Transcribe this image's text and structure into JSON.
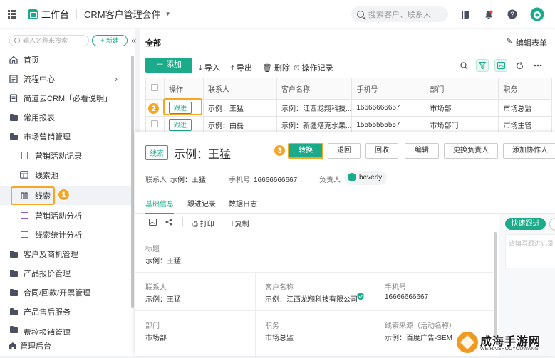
{
  "topbar": {
    "workspace": "工作台",
    "app_name": "CRM客户管理套件",
    "search_placeholder": "搜索客户、联系人"
  },
  "sidebar": {
    "search_placeholder": "输入名称来搜索",
    "new_label": "+ 新建",
    "items": [
      {
        "label": "首页"
      },
      {
        "label": "流程中心"
      },
      {
        "label": "简道云CRM「必看说明」"
      },
      {
        "label": "常用报表"
      },
      {
        "label": "市场营销管理"
      },
      {
        "label": "营销活动记录"
      },
      {
        "label": "线索池"
      },
      {
        "label": "线索"
      },
      {
        "label": "营销活动分析"
      },
      {
        "label": "线索统计分析"
      },
      {
        "label": "客户及商机管理"
      },
      {
        "label": "产品报价管理"
      },
      {
        "label": "合同/回款/开票管理"
      },
      {
        "label": "产品售后服务"
      },
      {
        "label": "费控报销管理"
      }
    ],
    "admin_label": "管理后台"
  },
  "annotations": {
    "b1": "1",
    "b2": "2",
    "b3": "3"
  },
  "main": {
    "breadcrumb": "全部",
    "edit_form": "编辑表单",
    "toolbar": {
      "add": "添加",
      "import": "导入",
      "export": "导出",
      "delete": "删除",
      "oplog": "操作记录"
    },
    "table": {
      "columns": [
        "操作",
        "联系人",
        "客户名称",
        "手机号",
        "部门",
        "职务"
      ],
      "rows": [
        {
          "action": "跟进",
          "contact": "示例：王猛",
          "customer": "示例：江西龙翔科技...",
          "phone": "16666666667",
          "dept": "市场部",
          "title": "市场总监"
        },
        {
          "action": "跟进",
          "contact": "示例：曲磊",
          "customer": "示例：新疆塔克水果...",
          "phone": "15555555557",
          "dept": "市场部门",
          "title": "市场主管"
        }
      ]
    }
  },
  "detail": {
    "tag": "线索",
    "title": "示例：王猛",
    "buttons": {
      "convert": "转换",
      "back": "退回",
      "recycle": "回收",
      "edit": "编辑",
      "change_owner": "更换负责人",
      "add_collab": "添加协作人"
    },
    "meta": {
      "contact_label": "联系人",
      "contact": "示例：王猛",
      "phone_label": "手机号",
      "phone": "16666666667",
      "owner_label": "负责人",
      "owner": "beverly"
    },
    "tabs": [
      "基础信息",
      "跟进记录",
      "数据日志"
    ],
    "tools": {
      "print": "打印",
      "copy": "复制"
    },
    "fields": {
      "title_label": "标题",
      "title_val": "示例：王猛",
      "contact_label": "联系人",
      "contact_val": "示例：王猛",
      "customer_label": "客户名称",
      "customer_val": "示例：江西龙翔科技有限公司",
      "phone_label": "手机号",
      "phone_val": "16666666667",
      "dept_label": "部门",
      "dept_val": "市场部",
      "job_label": "职务",
      "job_val": "市场总监",
      "source_label": "线索来源（活动名称）",
      "source_val": "示例：百度广告-SEM"
    },
    "quick_follow": "快速跟进",
    "note_placeholder": "请填写跟进记录"
  },
  "watermark": {
    "line1": "成海手游网",
    "line2": "WEIHAISHOUYOUWANG"
  }
}
